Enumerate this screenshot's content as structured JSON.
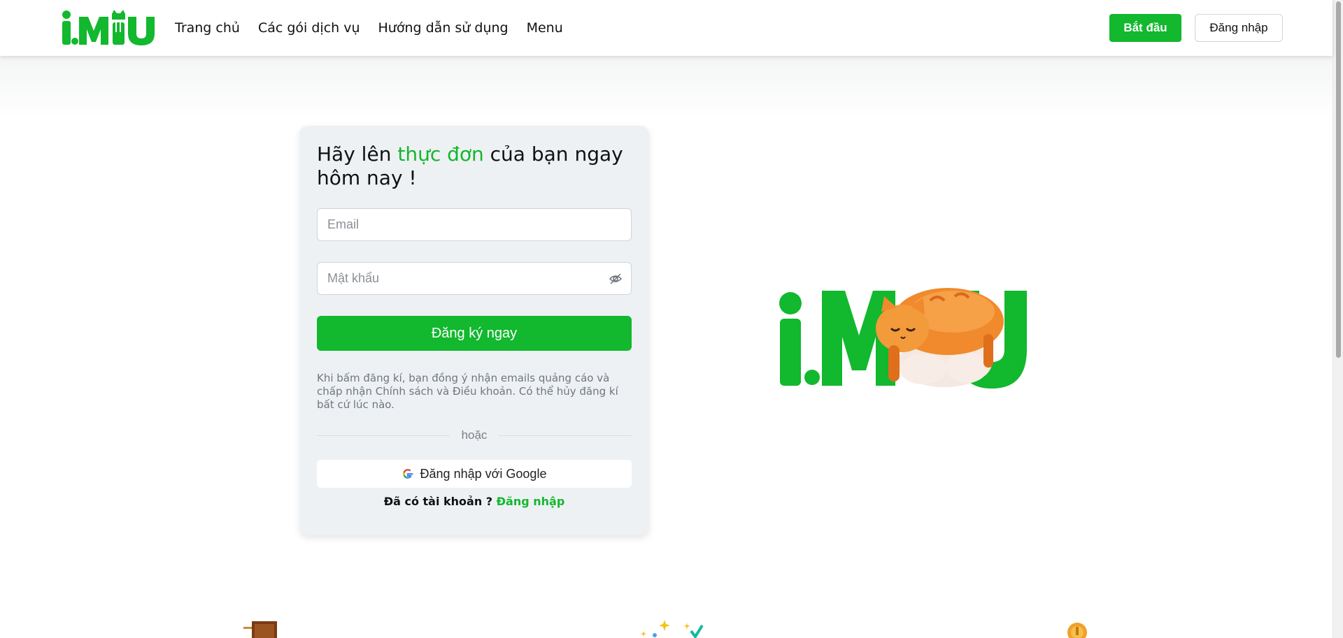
{
  "navbar": {
    "logo_text": "iMiU",
    "links": [
      {
        "label": "Trang chủ"
      },
      {
        "label": "Các gói dịch vụ"
      },
      {
        "label": "Hướng dẫn sử dụng"
      },
      {
        "label": "Menu"
      }
    ],
    "start_label": "Bắt đầu",
    "login_label": "Đăng nhập"
  },
  "form": {
    "headline_prefix": "Hãy lên ",
    "headline_accent": "thực đơn",
    "headline_suffix": " của bạn ngay hôm nay !",
    "email_placeholder": "Email",
    "password_placeholder": "Mật khẩu",
    "register_label": "Đăng ký ngay",
    "terms_text": "Khi bấm đăng kí, bạn đồng ý nhận emails quảng cáo và chấp nhận Chính sách và Điều khoản. Có thể hủy đăng kí bất cứ lúc nào.",
    "divider_text": "hoặc",
    "google_label": "Đăng nhập với Google",
    "have_account_text": "Đã có tài khoản ? ",
    "signin_link_label": "Đăng nhập"
  },
  "hero": {
    "logo_text": "iMiU"
  },
  "colors": {
    "brand_green": "#12b82d",
    "card_bg": "#eef1f4",
    "cat_orange": "#f08a2c"
  },
  "icons": [
    "eye-off-icon",
    "google-icon",
    "door-icon",
    "sparkle-icon",
    "coin-icon"
  ]
}
